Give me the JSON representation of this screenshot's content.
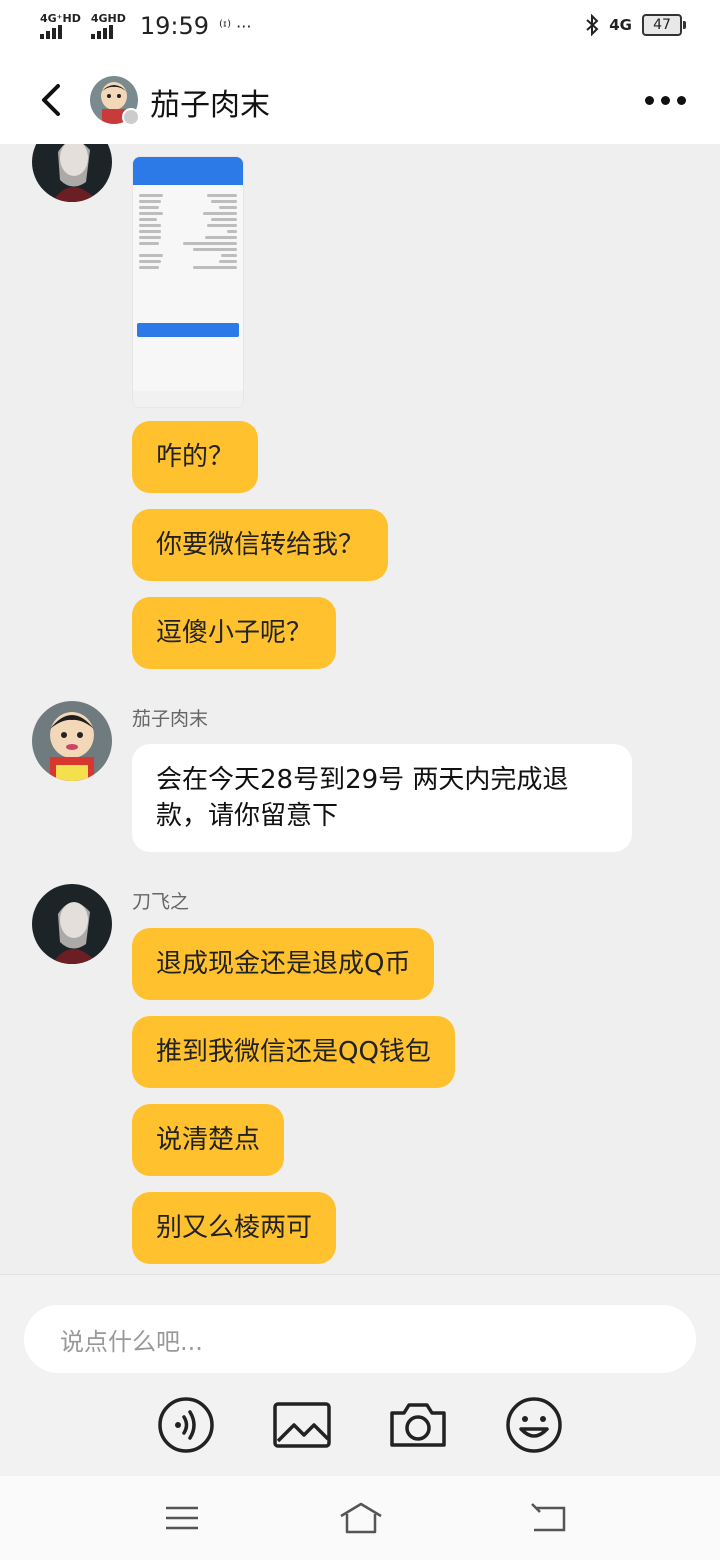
{
  "status": {
    "signal1": "4G⁺HD",
    "signal2": "4GHD",
    "time": "19:59",
    "extra": "⁽ᶦ⁾ ···",
    "net": "4G",
    "battery": "47"
  },
  "header": {
    "title": "茄子肉末"
  },
  "messages": {
    "group1": [
      "咋的？",
      "你要微信转给我？",
      "逗傻小子呢？"
    ],
    "reply_sender": "茄子肉末",
    "reply_text": "会在今天28号到29号 两天内完成退款，请你留意下",
    "group2_sender": "刀飞之",
    "group2": [
      "退成现金还是退成Q币",
      "推到我微信还是QQ钱包",
      "说清楚点",
      "别又么棱两可"
    ]
  },
  "composer": {
    "placeholder": "说点什么吧..."
  },
  "colors": {
    "bubble_self": "#ffc12e",
    "bubble_other": "#ffffff",
    "background": "#efefef"
  }
}
